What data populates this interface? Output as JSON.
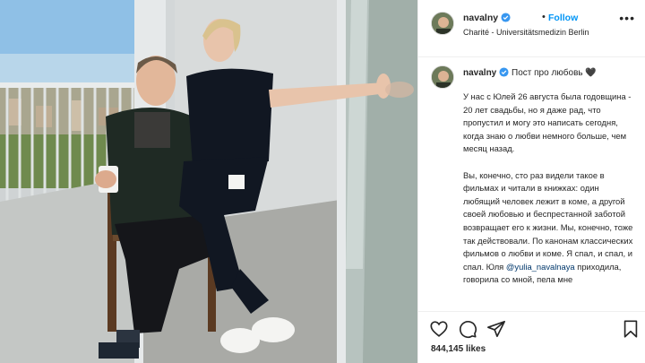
{
  "post": {
    "username": "navalny",
    "follow_label": "Follow",
    "separator": "•",
    "location": "Charité - Universitätsmedizin Berlin",
    "more_glyph": "•••"
  },
  "caption": {
    "username": "navalny",
    "title": "Пост про любовь",
    "title_emoji": "🖤",
    "paragraph1": "У нас с Юлей 26 августа была годовщина - 20 лет свадьбы, но я даже рад, что пропустил и могу это написать сегодня, когда знаю о любви немного больше, чем месяц назад.",
    "paragraph2": "Вы, конечно, сто раз видели такое в фильмах и читали в книжках: один любящий человек лежит в коме, а другой своей любовью и беспрестанной заботой возвращает его к жизни. Мы, конечно, тоже так действовали. По канонам классических фильмов о любви и коме. Я спал, и спал, и спал. Юля",
    "mention": "@yulia_navalnaya",
    "paragraph2_tail": " приходила, говорила со мной, пела мне"
  },
  "actions": {
    "like_icon": "heart-icon",
    "comment_icon": "comment-icon",
    "share_icon": "share-icon",
    "save_icon": "bookmark-icon"
  },
  "likes": {
    "count": "844,145",
    "label": "likes"
  },
  "colors": {
    "link_blue": "#0095f6",
    "verified_blue": "#3897f0",
    "mention": "#00376b",
    "border": "#efefef"
  }
}
